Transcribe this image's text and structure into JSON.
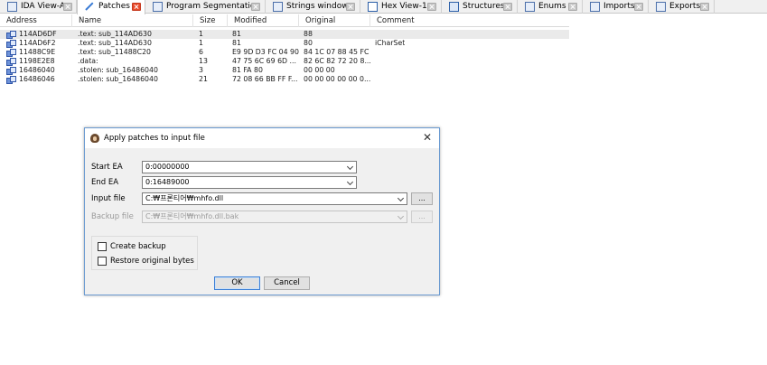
{
  "tabs": [
    {
      "label": "IDA View-A",
      "icon": "ida-view-icon",
      "active": false
    },
    {
      "label": "Patches",
      "icon": "patches-icon",
      "active": true
    },
    {
      "label": "Program Segmentation",
      "icon": "segmentation-icon",
      "active": false
    },
    {
      "label": "Strings window",
      "icon": "strings-icon",
      "active": false
    },
    {
      "label": "Hex View-1",
      "icon": "hex-view-icon",
      "active": false
    },
    {
      "label": "Structures",
      "icon": "structures-icon",
      "active": false
    },
    {
      "label": "Enums",
      "icon": "enums-icon",
      "active": false
    },
    {
      "label": "Imports",
      "icon": "imports-icon",
      "active": false
    },
    {
      "label": "Exports",
      "icon": "exports-icon",
      "active": false
    }
  ],
  "table": {
    "columns": [
      "Address",
      "Name",
      "Size",
      "Modified",
      "Original",
      "Comment"
    ],
    "rows": [
      {
        "address": "114AD6DF",
        "name": ".text: sub_114AD630",
        "size": "1",
        "modified": "81",
        "original": "88",
        "comment": ""
      },
      {
        "address": "114AD6F2",
        "name": ".text: sub_114AD630",
        "size": "1",
        "modified": "81",
        "original": "80",
        "comment": "iCharSet"
      },
      {
        "address": "11488C9E",
        "name": ".text: sub_11488C20",
        "size": "6",
        "modified": "E9 9D D3 FC 04 90",
        "original": "84 1C 07 88 45 FC",
        "comment": ""
      },
      {
        "address": "1198E2E8",
        "name": ".data:",
        "size": "13",
        "modified": "47 75 6C 69 6D ...",
        "original": "82 6C 82 72 20 8...",
        "comment": ""
      },
      {
        "address": "16486040",
        "name": ".stolen: sub_16486040",
        "size": "3",
        "modified": "81 FA 80",
        "original": "00 00 00",
        "comment": ""
      },
      {
        "address": "16486046",
        "name": ".stolen: sub_16486040",
        "size": "21",
        "modified": "72 08 66 BB FF F...",
        "original": "00 00 00 00 00 0...",
        "comment": ""
      }
    ]
  },
  "dialog": {
    "title": "Apply patches to input file",
    "close_glyph": "✕",
    "start_ea": {
      "label": "Start EA",
      "value": "0:00000000"
    },
    "end_ea": {
      "label": "End EA",
      "value": "0:16489000"
    },
    "input_file": {
      "label": "Input file",
      "value": "C:₩프론티어₩mhfo.dll",
      "browse": "..."
    },
    "backup_file": {
      "label": "Backup file",
      "value": "C:₩프론티어₩mhfo.dll.bak",
      "browse": "...",
      "enabled": false
    },
    "create_backup": {
      "label": "Create backup",
      "checked": false
    },
    "restore_original": {
      "label": "Restore original bytes",
      "checked": false
    },
    "ok": "OK",
    "cancel": "Cancel"
  },
  "colors": {
    "tab_strip": "#f0f0f0",
    "close_active": "#e84b2c",
    "dialog_border": "#6b9bd1",
    "default_button_border": "#3c7fd6"
  }
}
